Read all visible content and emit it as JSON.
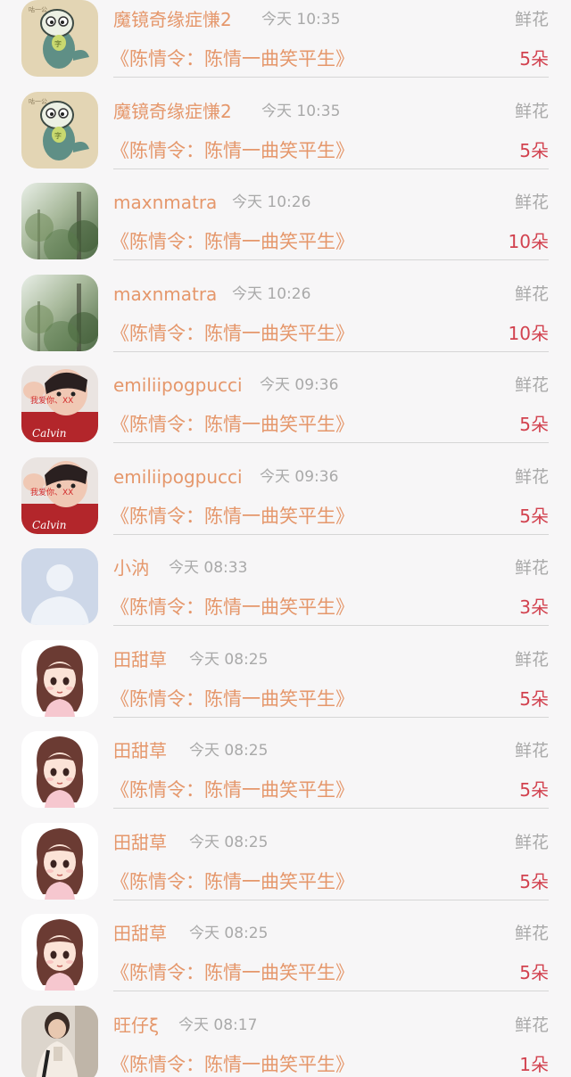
{
  "records": [
    {
      "name": "魔镜奇缘症慊2",
      "time": "今天 10:35",
      "type": "鲜花",
      "title": "《陈情令：陈情一曲笑平生》",
      "amount": "5朵",
      "avatar": "fish-cartoon"
    },
    {
      "name": "魔镜奇缘症慊2",
      "time": "今天 10:35",
      "type": "鲜花",
      "title": "《陈情令：陈情一曲笑平生》",
      "amount": "5朵",
      "avatar": "fish-cartoon"
    },
    {
      "name": "maxnmatra",
      "time": "今天 10:26",
      "type": "鲜花",
      "title": "《陈情令：陈情一曲笑平生》",
      "amount": "10朵",
      "avatar": "forest-photo"
    },
    {
      "name": "maxnmatra",
      "time": "今天 10:26",
      "type": "鲜花",
      "title": "《陈情令：陈情一曲笑平生》",
      "amount": "10朵",
      "avatar": "forest-photo"
    },
    {
      "name": "emiliipogpucci",
      "time": "今天 09:36",
      "type": "鲜花",
      "title": "《陈情令：陈情一曲笑平生》",
      "amount": "5朵",
      "avatar": "person-red-shirt"
    },
    {
      "name": "emiliipogpucci",
      "time": "今天 09:36",
      "type": "鲜花",
      "title": "《陈情令：陈情一曲笑平生》",
      "amount": "5朵",
      "avatar": "person-red-shirt"
    },
    {
      "name": "小汭",
      "time": "今天 08:33",
      "type": "鲜花",
      "title": "《陈情令：陈情一曲笑平生》",
      "amount": "3朵",
      "avatar": "default-user"
    },
    {
      "name": "田甜草",
      "time": "今天 08:25",
      "type": "鲜花",
      "title": "《陈情令：陈情一曲笑平生》",
      "amount": "5朵",
      "avatar": "anime-girl"
    },
    {
      "name": "田甜草",
      "time": "今天 08:25",
      "type": "鲜花",
      "title": "《陈情令：陈情一曲笑平生》",
      "amount": "5朵",
      "avatar": "anime-girl"
    },
    {
      "name": "田甜草",
      "time": "今天 08:25",
      "type": "鲜花",
      "title": "《陈情令：陈情一曲笑平生》",
      "amount": "5朵",
      "avatar": "anime-girl"
    },
    {
      "name": "田甜草",
      "time": "今天 08:25",
      "type": "鲜花",
      "title": "《陈情令：陈情一曲笑平生》",
      "amount": "5朵",
      "avatar": "anime-girl"
    },
    {
      "name": "旺仔ξ",
      "time": "今天 08:17",
      "type": "鲜花",
      "title": "《陈情令：陈情一曲笑平生》",
      "amount": "1朵",
      "avatar": "person-photo"
    }
  ],
  "colors": {
    "name": "#e5976b",
    "title": "#e5976b",
    "amount": "#d2424f",
    "meta": "#a9a9a9",
    "background": "#f7f6f7"
  },
  "avatar_text": {
    "fish-cartoon": "咕一公",
    "person-red-shirt": "我爱你、XX"
  }
}
